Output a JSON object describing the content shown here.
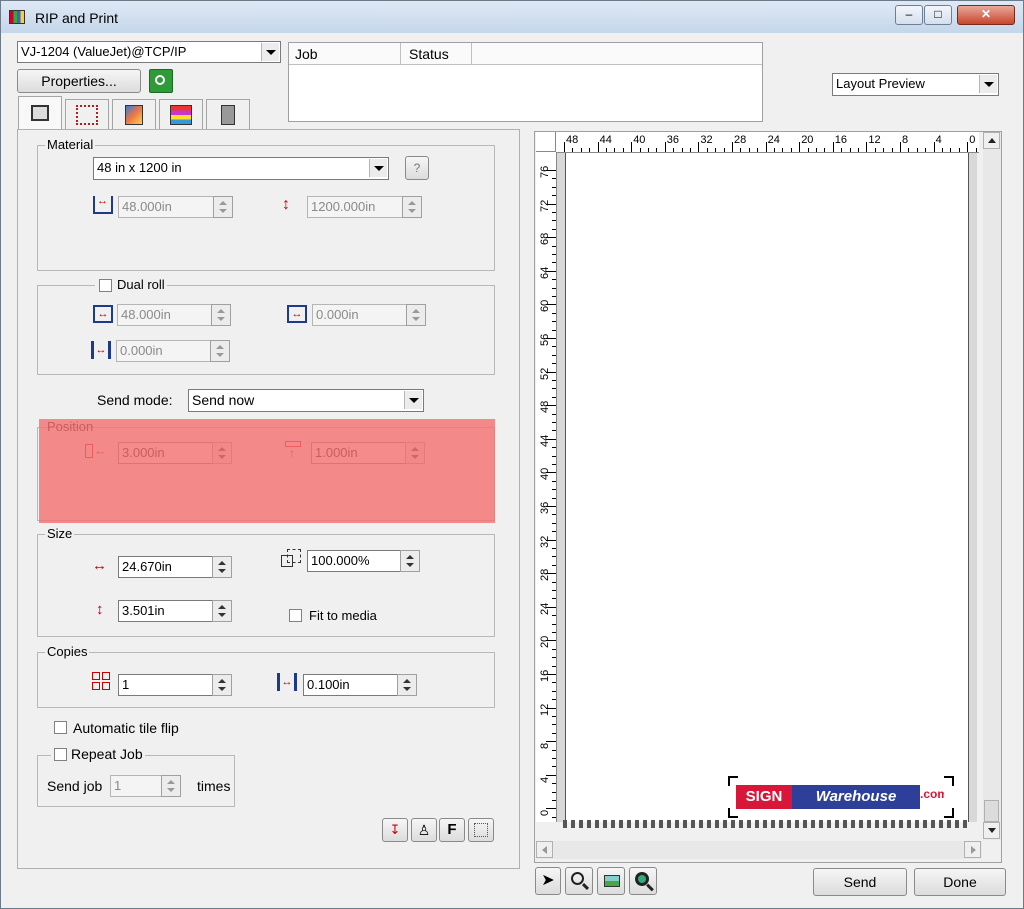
{
  "window": {
    "title": "RIP and Print"
  },
  "printer": {
    "selected": "VJ-1204 (ValueJet)@TCP/IP",
    "properties_label": "Properties..."
  },
  "jobs": {
    "columns": [
      "Job",
      "Status"
    ]
  },
  "preview_select": {
    "selected": "Layout Preview"
  },
  "material": {
    "label": "Material",
    "media": "48 in x 1200 in",
    "width": "48.000in",
    "length": "1200.000in"
  },
  "dual_roll": {
    "label": "Dual roll",
    "roll_width": "48.000in",
    "roll_offset": "0.000in",
    "gap": "0.000in"
  },
  "send_mode": {
    "label": "Send mode:",
    "value": "Send now"
  },
  "position": {
    "label": "Position",
    "x": "3.000in",
    "y": "1.000in"
  },
  "size": {
    "label": "Size",
    "width": "24.670in",
    "height": "3.501in",
    "scale": "100.000%",
    "fit_label": "Fit to media"
  },
  "copies": {
    "label": "Copies",
    "count": "1",
    "spacing": "0.100in"
  },
  "options": {
    "auto_tile_flip": "Automatic tile flip",
    "repeat_job": "Repeat Job",
    "send_job_label": "Send job",
    "send_job_value": "1",
    "times_label": "times"
  },
  "bottom_tools": {
    "f_label": "F"
  },
  "ruler": {
    "h_ticks": [
      "48",
      "44",
      "40",
      "36",
      "32",
      "28",
      "24",
      "20",
      "16",
      "12",
      "8",
      "4",
      "0"
    ],
    "v_ticks": [
      "76",
      "72",
      "68",
      "64",
      "60",
      "56",
      "52",
      "48",
      "44",
      "40",
      "36",
      "32",
      "28",
      "24",
      "20",
      "16",
      "12",
      "8",
      "4",
      "0"
    ]
  },
  "preview_logo": {
    "part1": "SIGN",
    "part2": "Warehouse",
    "suffix": ".com"
  },
  "buttons": {
    "send": "Send",
    "done": "Done"
  },
  "colors": {
    "highlight": "#f47272",
    "logo_red": "#d8163a",
    "logo_blue": "#2e3f9a"
  }
}
